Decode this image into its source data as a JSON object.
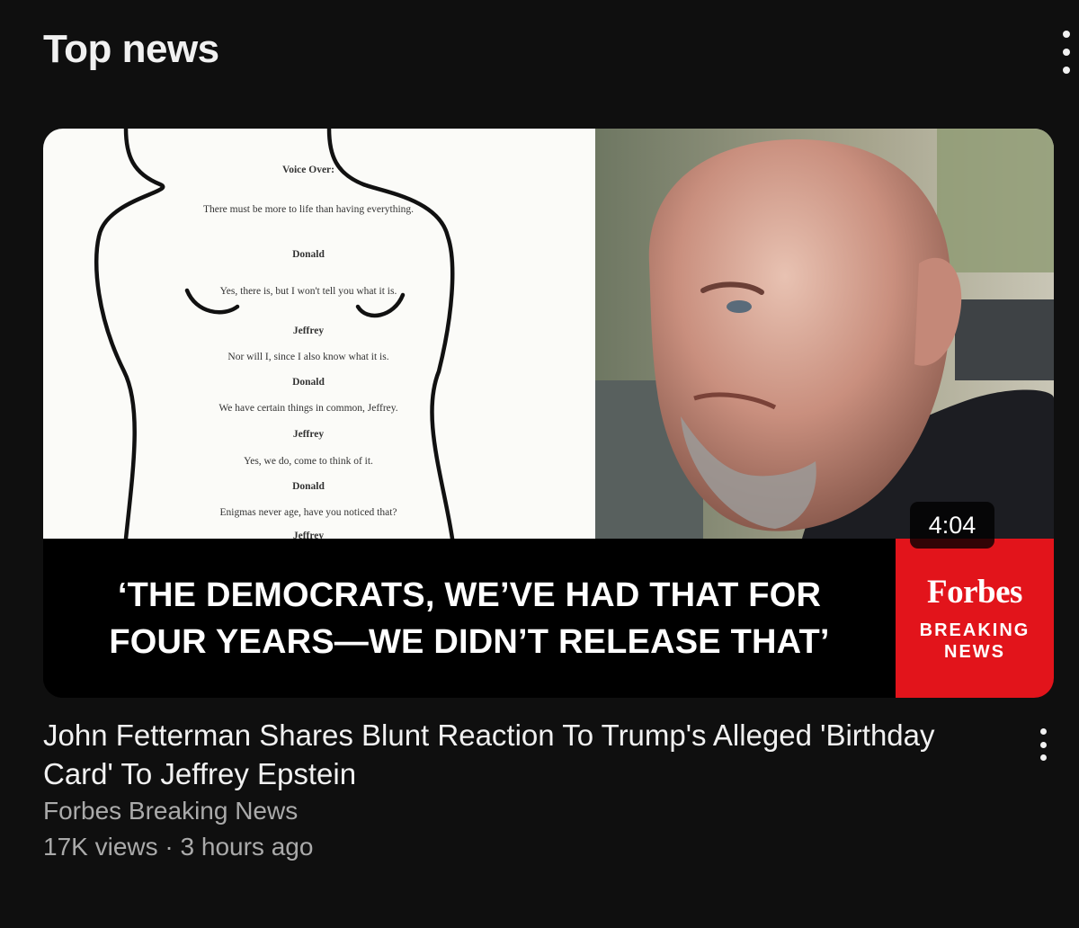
{
  "section": {
    "title": "Top news",
    "menu_icon": "more-vert-icon"
  },
  "video": {
    "title": "John Fetterman Shares Blunt Reaction To Trump's Alleged 'Birthday Card' To Jeffrey Epstein",
    "channel": "Forbes Breaking News",
    "views": "17K views",
    "separator": "·",
    "age": "3 hours ago",
    "duration": "4:04",
    "menu_icon": "more-vert-icon",
    "thumbnail": {
      "document_lines": [
        "Voice Over:",
        "There must be more to life than having everything.",
        "Donald",
        "Yes, there is, but I won't tell you what it is.",
        "Jeffrey",
        "Nor will I, since I also know what it is.",
        "Donald",
        "We have certain things in common, Jeffrey.",
        "Jeffrey",
        "Yes, we do, come to think of it.",
        "Donald",
        "Enigmas never age, have you noticed that?",
        "Jeffrey"
      ],
      "headline_line1": "‘THE DEMOCRATS, WE’VE HAD THAT FOR",
      "headline_line2": "FOUR YEARS—WE DIDN’T RELEASE THAT’",
      "brand_name": "Forbes",
      "brand_sub_line1": "BREAKING",
      "brand_sub_line2": "NEWS",
      "brand_color": "#e2141b"
    }
  },
  "colors": {
    "background": "#0f0f0f",
    "primary_text": "#f1f1f1",
    "secondary_text": "#aaaaaa"
  }
}
